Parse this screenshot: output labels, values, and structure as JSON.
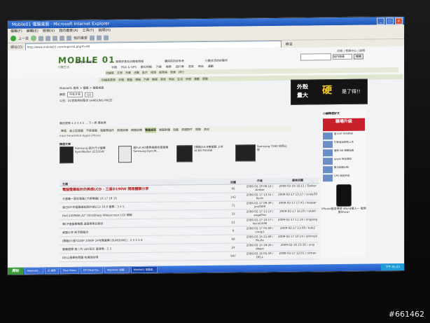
{
  "browser": {
    "title": "Mobile01 電腦桌面 - Microsoft Internet Explorer",
    "menu": [
      "檔案(F)",
      "編輯(E)",
      "檢視(V)",
      "我的最愛(A)",
      "工具(T)",
      "說明(H)"
    ],
    "toolbar": {
      "back_label": "上一頁",
      "favorites_label": "我的最愛"
    },
    "address": {
      "label": "網址(D)",
      "value": "http://www.mobile01.com/topiclist.php?f=90",
      "go_label": "移至"
    }
  },
  "site": {
    "logo": "MOBILE 01",
    "logo_sub": "行動生活",
    "top_links": "註冊 | 會員中心 | 說明",
    "search": {
      "placeholder": "",
      "select": "站內搜尋",
      "button": "搜尋"
    },
    "head_links": [
      "消費者的好朋友",
      "專業評測及消費者情報",
      "購買前的好參考",
      "行動生活的好夥伴"
    ],
    "nav1": [
      "手機",
      "PDA & GPS",
      "數位相機",
      "汽車",
      "機車",
      "自行車",
      "居家",
      "時尚",
      "運動"
    ],
    "nav2": [
      "討論區",
      "文章",
      "市集",
      "活動",
      "影片",
      "相簿",
      "部落格",
      "會員",
      "排行"
    ],
    "subnav": [
      "討論區首頁",
      "手機",
      "電腦",
      "相機",
      "汽車",
      "機車",
      "居家",
      "時尚",
      "生活",
      "休閒",
      "運動",
      "閒聊"
    ],
    "breadcrumb": "Mobile01 首頁 > 電腦 > 電腦桌面",
    "filter": {
      "label": "篩選",
      "value": "所有文章",
      "button": "GO"
    },
    "announcement": "公告：01會員資料整合 SAMSUNG PRIZE",
    "ad": {
      "line1": "外殼",
      "line2": "硬",
      "line3": "是了得!!",
      "sub": "量大"
    },
    "page_info": "最近更新 1 2 3 4 5 ... 下一頁  最後頁",
    "categories": {
      "items": [
        "筆電",
        "桌上型電腦",
        "平板電腦",
        "電腦零組件",
        "周邊設備",
        "網路設備",
        "電腦桌面",
        "電腦軟體",
        "遊戲",
        "周邊配件",
        "閒聊",
        "其他"
      ],
      "active_index": 6
    },
    "categories2": "Intel  SmartShot  Apple iPhone",
    "featured_title": "精選文章",
    "featured": [
      {
        "text": "Samsung 超大尺寸螢幕 SyncMaster 2233GW"
      },
      {
        "text": "超Full HD畫質高解析度螢幕 Samsung SyncM..."
      },
      {
        "text": "[開箱]16:9寬螢幕 上市 ACER P244W"
      },
      {
        "text": "Samsung T260 試用心得"
      }
    ],
    "list": {
      "headers": [
        "主題",
        "回覆",
        "作者",
        "最後回覆"
      ],
      "rows": [
        {
          "title": "電腦螢幕設計的美感LCD - 三星D190W 開箱體驗分享",
          "replies": "95",
          "author": "2009-02-19 06:12 / Amber",
          "last": "2009-02-19 16:11 / Tanker"
        },
        {
          "title": "大螢幕一票在電腦 [大師專題] 16 17 18 19",
          "replies": "142",
          "author": "2009-02-17 13:51 / Kocki",
          "last": "2009-02-17 13:17 / cindy39"
        },
        {
          "title": "自己DIY的電腦桌組與外接LCD 16:9 螢幕 - 3 4 5",
          "replies": "71",
          "author": "2009-02-17 09:39 / jim0909",
          "last": "2009-02-17 17:41 / keeper"
        },
        {
          "title": "Dell 2209WA 22\" UltraSharp Widescreen LCD 開箱",
          "replies": "33",
          "author": "2009-02-17 11:13 / angelfire",
          "last": "2009-02-17 16:29 / rabbit"
        },
        {
          "title": "高CP值螢幕推薦 還是等等比較好",
          "replies": "12",
          "author": "2009-02-17 10:17 / kevin5566",
          "last": "2009-02-17 11:14 / jingyerg"
        },
        {
          "title": "桌面分享 新手開箱文",
          "replies": "9",
          "author": "2009-02-17 05:08 / cindy1",
          "last": "2009-02-17 11:09 / bob2"
        },
        {
          "title": "[開箱]三星T220P 1080P 24吋寬螢幕 [SUMSUNG] - 2 3 4 5 6",
          "replies": "68",
          "author": "2009-02-15 21:08 / Rlu2a",
          "last": "2009-02-17 10:14 / johnnyh"
        },
        {
          "title": "螢幕選擇 第二代 LED背光 值得嗎 - 2 3",
          "replies": "24",
          "author": "2009-02-15 18:26 / dkeps",
          "last": "2009-02-16 23:16 / uniy"
        },
        {
          "title": "DELL螢幕有問題 有遇到的嗎",
          "replies": "947",
          "author": "2009-02-16 05:59 / DELL",
          "last": "2009-02-17 12:01 / ritman"
        }
      ]
    },
    "side": {
      "title": "小編精選好文",
      "banner": "職場升級",
      "items": [
        "富士XP 系列評測",
        "行動電話新款上市",
        "最新 NB 選購指南",
        "Apple 新品資訊",
        "數位相機比較",
        "GPS 導航評測"
      ],
      "iphone_caption": "iPhone變身導遊 iBand讓人一 當便當Show!"
    }
  },
  "taskbar": {
    "start": "開始",
    "tasks": [
      "Mobile01...",
      "IE 桌面",
      "Total Video",
      "DTI Total Da...",
      "Mobile01 電腦...",
      "Mobile01 電腦桌..."
    ],
    "active_index": 5,
    "clock": "下午 05:25"
  },
  "watermark": "#661462"
}
